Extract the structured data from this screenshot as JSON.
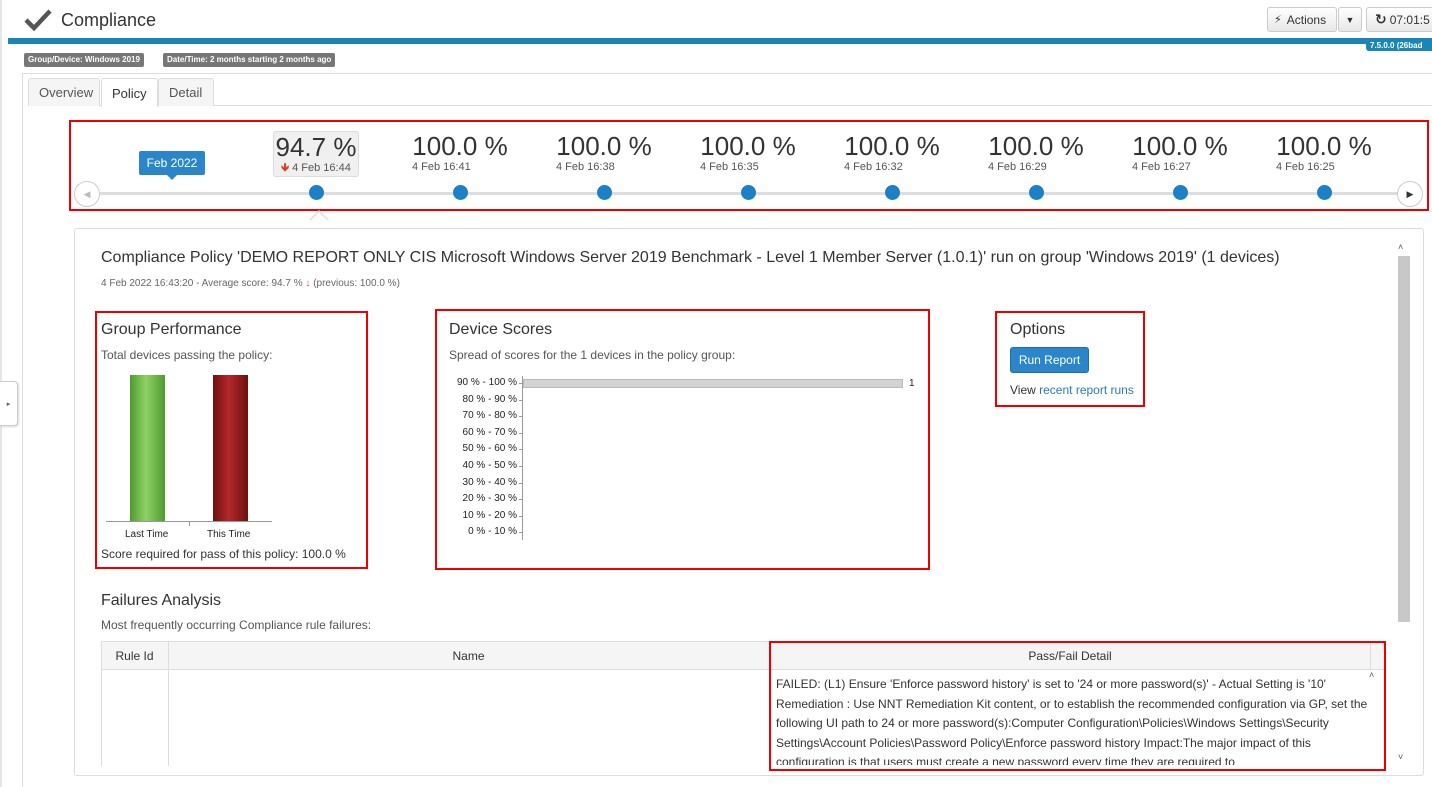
{
  "header": {
    "app_icon": "checkmark-icon",
    "title": "Compliance",
    "actions_label": "Actions",
    "actions_icon": "bolt-icon",
    "dropdown_icon": "caret-down-icon",
    "refresh_icon": "refresh-icon",
    "time": "07:01:5",
    "version": "7.5.0.0 (26bad"
  },
  "filters": {
    "group_device": "Group/Device: Windows 2019",
    "date_time": "Date/Time: 2 months starting 2 months ago"
  },
  "tabs": [
    {
      "label": "Overview",
      "active": false
    },
    {
      "label": "Policy",
      "active": true
    },
    {
      "label": "Detail",
      "active": false
    }
  ],
  "timeline": {
    "month_label": "Feb 2022",
    "items": [
      {
        "score": "94.7 %",
        "date": "4 Feb 16:44",
        "trend": "down",
        "selected": true
      },
      {
        "score": "100.0 %",
        "date": "4 Feb 16:41"
      },
      {
        "score": "100.0 %",
        "date": "4 Feb 16:38"
      },
      {
        "score": "100.0 %",
        "date": "4 Feb 16:35"
      },
      {
        "score": "100.0 %",
        "date": "4 Feb 16:32"
      },
      {
        "score": "100.0 %",
        "date": "4 Feb 16:29"
      },
      {
        "score": "100.0 %",
        "date": "4 Feb 16:27"
      },
      {
        "score": "100.0 %",
        "date": "4 Feb 16:25"
      }
    ]
  },
  "report": {
    "title": "Compliance Policy 'DEMO REPORT ONLY CIS Microsoft Windows Server 2019 Benchmark - Level 1 Member Server (1.0.1)' run on group 'Windows 2019' (1 devices)",
    "subtitle_prefix": "4 Feb 2022 16:43:20 - Average score: 94.7 %",
    "subtitle_suffix": "(previous: 100.0 %)"
  },
  "group_performance": {
    "title": "Group Performance",
    "subtitle": "Total devices passing the policy:",
    "footer": "Score required for pass of this policy: 100.0 %",
    "colors": {
      "last_time": "#6ab84a",
      "this_time": "#9b1c1f"
    }
  },
  "device_scores": {
    "title": "Device Scores",
    "subtitle": "Spread of scores for the 1 devices in the policy group:"
  },
  "chart_data": [
    {
      "type": "bar",
      "categories": [
        "Last Time",
        "This Time"
      ],
      "values": [
        1,
        1
      ]
    },
    {
      "type": "bar",
      "orientation": "horizontal",
      "categories": [
        "90 % - 100 %",
        "80 % - 90 %",
        "70 % - 80 %",
        "60 % - 70 %",
        "50 % - 60 %",
        "40 % - 50 %",
        "30 % - 40 %",
        "20 % - 30 %",
        "10 % - 20 %",
        "0 % - 10 %"
      ],
      "values": [
        1,
        0,
        0,
        0,
        0,
        0,
        0,
        0,
        0,
        0
      ]
    }
  ],
  "options": {
    "title": "Options",
    "run_report_label": "Run Report",
    "view_prefix": "View",
    "view_link": "recent report runs"
  },
  "failures": {
    "title": "Failures Analysis",
    "subtitle": "Most frequently occurring Compliance rule failures:",
    "columns": [
      "Rule Id",
      "Name",
      "Pass/Fail Detail"
    ],
    "rows": [
      {
        "rule_id": "",
        "name": "",
        "detail": "FAILED: (L1) Ensure 'Enforce password history' is set to '24 or more password(s)' - Actual Setting is '10' Remediation : Use NNT Remediation Kit content, or to establish the recommended configuration via GP, set the following UI path to 24 or more password(s):Computer Configuration\\Policies\\Windows Settings\\Security Settings\\Account Policies\\Password Policy\\Enforce password history Impact:The major impact of this configuration is that users must create a new password every time they are required to"
      }
    ]
  }
}
